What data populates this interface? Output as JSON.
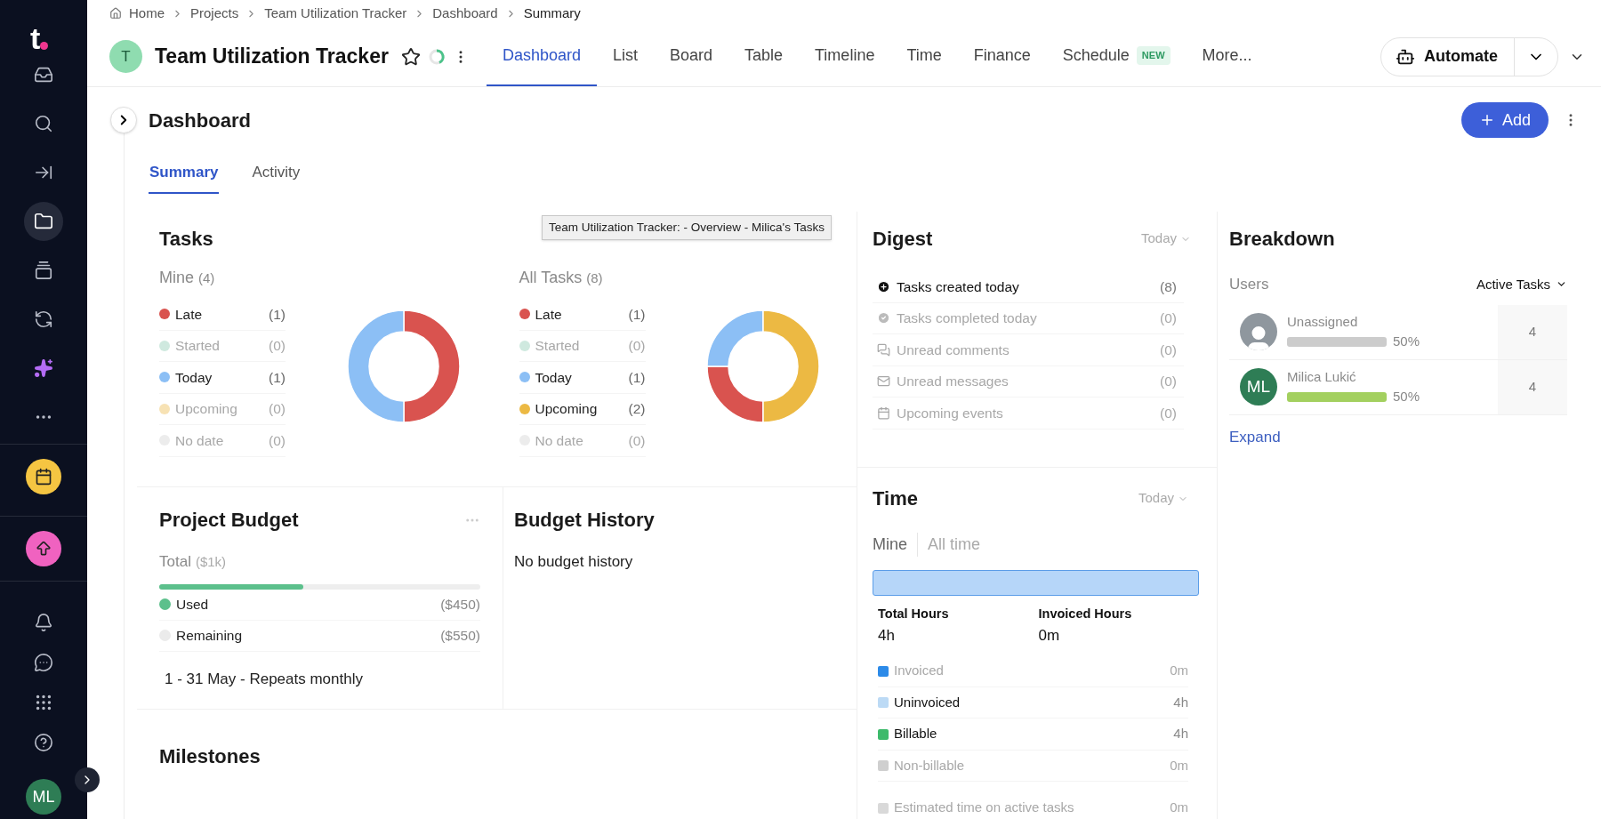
{
  "sidebar": {
    "logo": "t",
    "items": [
      {
        "selected": false
      },
      {
        "selected": false
      },
      {
        "selected": false
      },
      {
        "selected": true
      },
      {
        "selected": false
      },
      {
        "selected": false
      },
      {
        "selected": false
      },
      {
        "selected": false
      }
    ],
    "quick": [
      {
        "kind": "calendar",
        "color": "#f5c542"
      },
      {
        "kind": "upgrade",
        "color": "#f062c0"
      }
    ],
    "bottom": [
      {
        "selected": false
      },
      {
        "selected": false
      },
      {
        "selected": false
      },
      {
        "selected": false
      }
    ],
    "avatar": "ML"
  },
  "breadcrumb": [
    "Home",
    "Projects",
    "Team Utilization Tracker",
    "Dashboard",
    "Summary"
  ],
  "project": {
    "initial": "T",
    "title": "Team Utilization Tracker"
  },
  "tabs": [
    {
      "label": "Dashboard",
      "selected": true
    },
    {
      "label": "List",
      "selected": false
    },
    {
      "label": "Board",
      "selected": false
    },
    {
      "label": "Table",
      "selected": false
    },
    {
      "label": "Timeline",
      "selected": false
    },
    {
      "label": "Time",
      "selected": false
    },
    {
      "label": "Finance",
      "selected": false
    },
    {
      "label": "Schedule",
      "selected": false,
      "badge": "NEW"
    },
    {
      "label": "More...",
      "selected": false
    }
  ],
  "automate": {
    "label": "Automate"
  },
  "page": {
    "title": "Dashboard",
    "add": "Add"
  },
  "subtabs": [
    {
      "label": "Summary",
      "selected": true
    },
    {
      "label": "Activity",
      "selected": false
    }
  ],
  "tooltip": "Team Utilization Tracker: - Overview - Milica's Tasks",
  "tasks": {
    "title": "Tasks",
    "groups": [
      {
        "label": "Mine",
        "count": "(4)",
        "items": [
          {
            "count": "(1)",
            "color": "#d9534f",
            "muted": false
          },
          {
            "count": "(0)",
            "color": "#cfe9df",
            "muted": true
          },
          {
            "count": "(1)",
            "color": "#8cbff5",
            "muted": false
          },
          {
            "count": "(0)",
            "color": "#f7e2b4",
            "muted": true
          },
          {
            "count": "(0)",
            "color": "#ececec",
            "muted": true
          }
        ],
        "chart_data": {
          "type": "donut",
          "categories": [
            "Late",
            "Started",
            "Today",
            "Upcoming",
            "No date"
          ],
          "values": [
            50,
            0,
            50,
            0,
            0
          ]
        }
      },
      {
        "label": "All Tasks",
        "count": "(8)",
        "items": [
          {
            "count": "(1)",
            "color": "#d9534f",
            "muted": false
          },
          {
            "count": "(0)",
            "color": "#cfe9df",
            "muted": true
          },
          {
            "count": "(1)",
            "color": "#8cbff5",
            "muted": false
          },
          {
            "count": "(2)",
            "color": "#ecb943",
            "muted": false
          },
          {
            "count": "(0)",
            "color": "#ececec",
            "muted": true
          }
        ],
        "chart_data": {
          "type": "donut",
          "categories": [
            "Late",
            "Started",
            "Today",
            "Upcoming",
            "No date"
          ],
          "values": [
            25,
            0,
            25,
            50,
            0
          ]
        }
      }
    ]
  },
  "digest": {
    "title": "Digest",
    "period": "Today",
    "rows": [
      {
        "kind": "created",
        "label": "Tasks created today",
        "count": "(8)",
        "muted": false
      },
      {
        "kind": "completed",
        "label": "Tasks completed today",
        "count": "(0)",
        "muted": true
      },
      {
        "kind": "comments",
        "label": "Unread comments",
        "count": "(0)",
        "muted": true
      },
      {
        "kind": "messages",
        "label": "Unread messages",
        "count": "(0)",
        "muted": true
      },
      {
        "kind": "events",
        "label": "Upcoming events",
        "count": "(0)",
        "muted": true
      }
    ]
  },
  "breakdown": {
    "title": "Breakdown",
    "users_label": "Users",
    "metric": "Active Tasks",
    "rows": [
      {
        "kind": "unassigned",
        "name": "Unassigned",
        "percent": "50%",
        "color": "#cccccc",
        "count": "4"
      },
      {
        "kind": "initials",
        "initials": "ML",
        "name": "Milica Lukić",
        "percent": "50%",
        "color": "#a3d05f",
        "count": "4"
      }
    ],
    "expand": "Expand"
  },
  "budget": {
    "title": "Project Budget",
    "total_label": "Total",
    "total": "($1k)",
    "level": 0.45,
    "items": [
      {
        "label": "Used",
        "amount": "($450)",
        "color": "#5cc08c"
      },
      {
        "label": "Remaining",
        "amount": "($550)",
        "color": "#ebebeb"
      }
    ],
    "period": "1 - 31 May - Repeats monthly"
  },
  "budget_history": {
    "title": "Budget History",
    "empty": "No budget history"
  },
  "time": {
    "title": "Time",
    "period": "Today",
    "tabs": [
      {
        "label": "Mine",
        "selected": true
      },
      {
        "label": "All time",
        "selected": false
      }
    ],
    "totals": [
      {
        "label": "Total Hours",
        "value": "4h"
      },
      {
        "label": "Invoiced Hours",
        "value": "0m"
      }
    ],
    "items": [
      {
        "label": "Invoiced",
        "value": "0m",
        "color": "#2c8ae8",
        "muted": true
      },
      {
        "label": "Uninvoiced",
        "value": "4h",
        "color": "#bcdaf5",
        "muted": false
      },
      {
        "label": "Billable",
        "value": "4h",
        "color": "#3dba6b",
        "muted": false
      },
      {
        "label": "Non-billable",
        "value": "0m",
        "color": "#cfcfcf",
        "muted": true
      },
      {
        "label": "Estimated time on active tasks",
        "value": "0m",
        "color": "#d9d9d9",
        "muted": true
      }
    ]
  },
  "milestones": {
    "title": "Milestones"
  }
}
